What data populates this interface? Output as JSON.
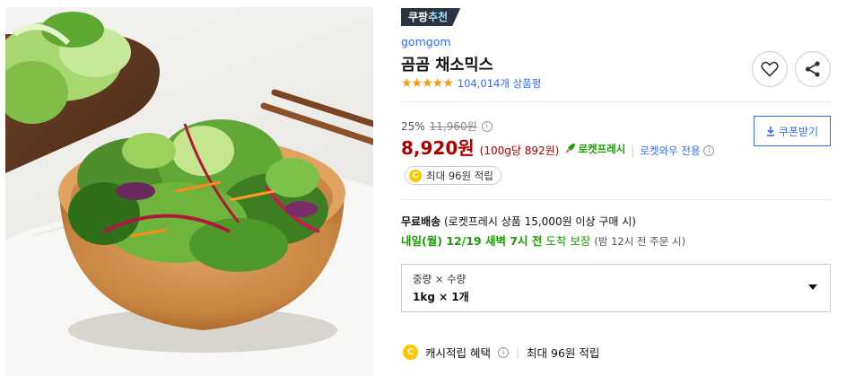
{
  "badge": {
    "prefix": "쿠팡",
    "highlight": "추천"
  },
  "brand": "gomgom",
  "title": "곰곰 채소믹스",
  "rating": {
    "stars_value": 4.5,
    "stars_glyphs": "★★★★★",
    "reviews": "104,014개 상품평"
  },
  "actions": {
    "favorite_icon": "heart-icon",
    "share_icon": "share-icon"
  },
  "pricing": {
    "discount_rate": "25%",
    "original_price": "11,960원",
    "info_icon": "i",
    "price": "8,920원",
    "unit_price": "(100g당 892원)",
    "delivery_badge": "로켓프레시",
    "separator": "|",
    "membership": "로켓와우 전용"
  },
  "coupon": {
    "label": "쿠폰받기"
  },
  "reward": {
    "coin": "C",
    "label": "최대 96원 적립"
  },
  "shipping": {
    "free_label": "무료배송",
    "condition": "(로켓프레시 상품 15,000원 이상 구매 시)",
    "arrival_date": "내일(월) 12/19 새벽 7시 전",
    "arrival_guarantee": "도착 보장",
    "order_deadline": "(밤 12시 전 주문 시)"
  },
  "option": {
    "label": "중량 × 수량",
    "value": "1kg × 1개"
  },
  "cash_reward": {
    "coin": "C",
    "label": "캐시적립 혜택",
    "separator": "|",
    "amount": "최대 96원 적립"
  },
  "colors": {
    "price": "#ae0000",
    "link": "#346aff",
    "fresh": "#18a000",
    "star": "#ff9a00",
    "badge_bg": "#2a3340"
  }
}
